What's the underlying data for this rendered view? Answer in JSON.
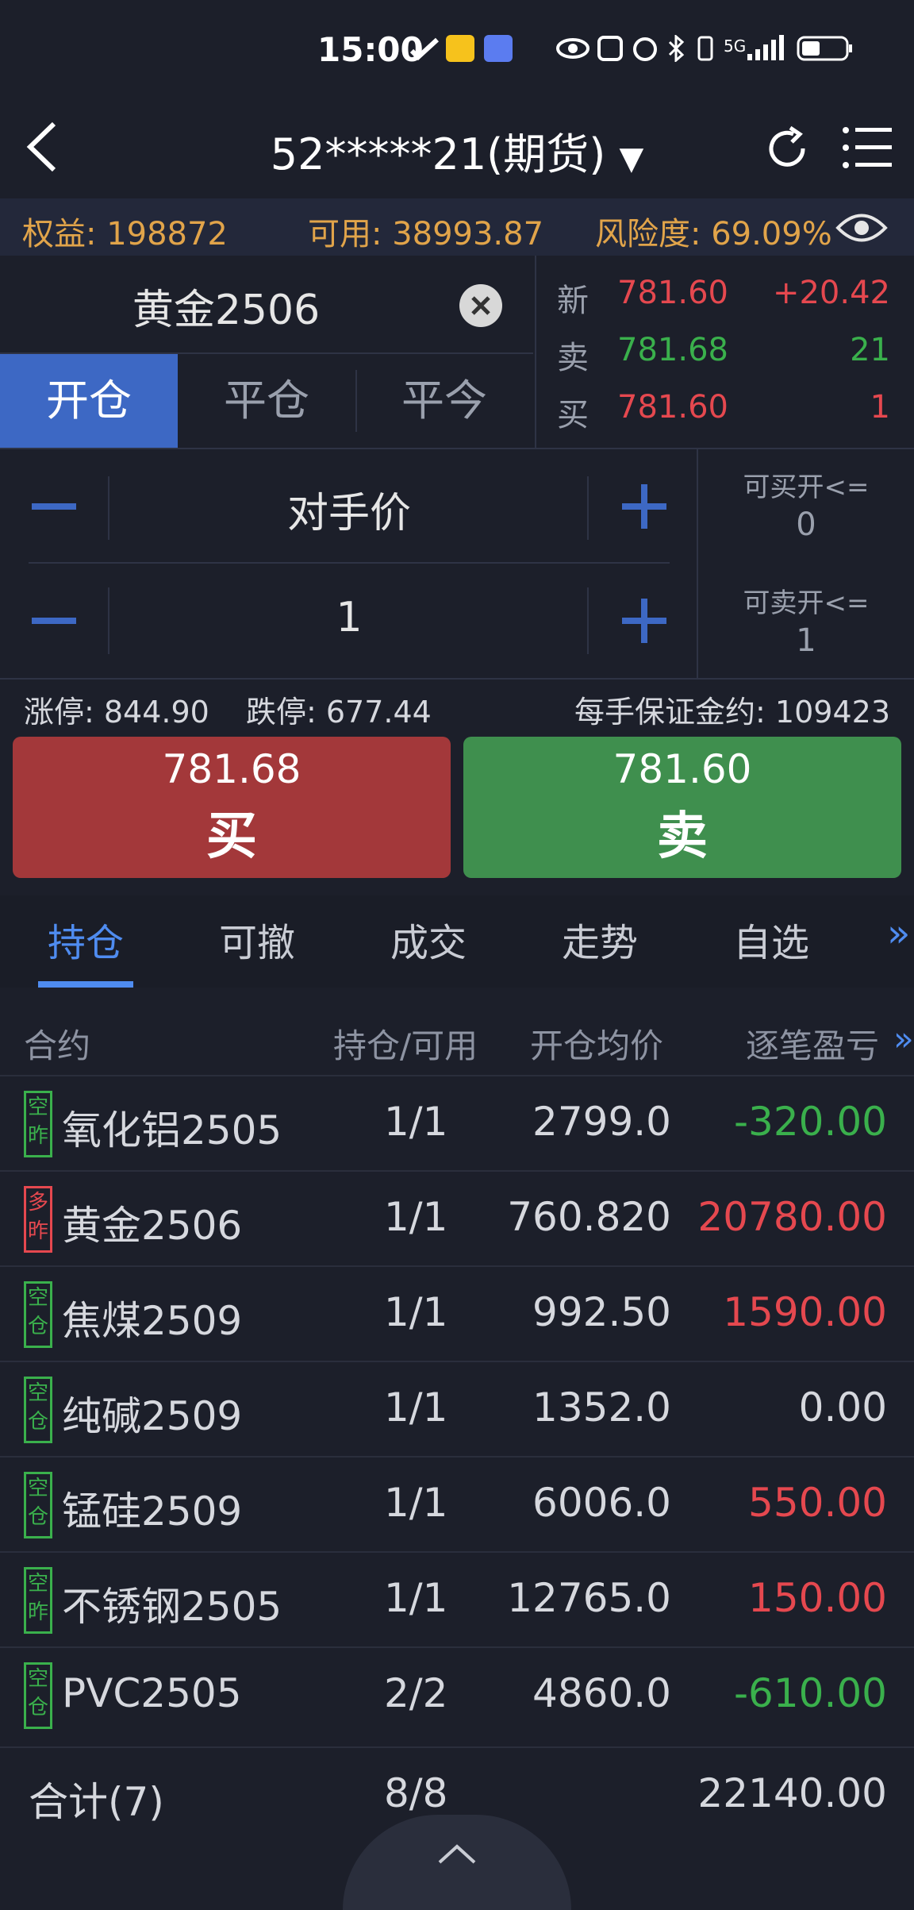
{
  "status_bar": {
    "time": "15:00",
    "network": "5G"
  },
  "header": {
    "account": "52*****21(期货)"
  },
  "equity": {
    "quanyi": "权益: 198872",
    "keyong": "可用: 38993.87",
    "risk": "风险度: 69.09%"
  },
  "instrument": {
    "name": "黄金2506"
  },
  "order_tabs": [
    "开仓",
    "平仓",
    "平今"
  ],
  "quote": [
    {
      "label": "新",
      "price": "781.60",
      "right": "+20.42"
    },
    {
      "label": "卖",
      "price": "781.68",
      "right": "21"
    },
    {
      "label": "买",
      "price": "781.60",
      "right": "1"
    }
  ],
  "price_field": {
    "value": "对手价"
  },
  "qty_field": {
    "value": "1"
  },
  "can_buy": {
    "label": "可买开<=",
    "value": "0"
  },
  "can_sell": {
    "label": "可卖开<=",
    "value": "1"
  },
  "limits": {
    "up": "涨停: 844.90",
    "down": "跌停: 677.44",
    "margin": "每手保证金约: 109423"
  },
  "buy_button": {
    "price": "781.68",
    "label": "买"
  },
  "sell_button": {
    "price": "781.60",
    "label": "卖"
  },
  "tabs": [
    "持仓",
    "可撤",
    "成交",
    "走势",
    "自选",
    "»"
  ],
  "table": {
    "headers": [
      "合约",
      "持仓/可用",
      "开仓均价",
      "逐笔盈亏",
      "»"
    ],
    "rows": [
      {
        "tag": "空昨",
        "tagc": "green",
        "name": "氧化铝2505",
        "pos": "1/1",
        "avg": "2799.0",
        "pnl": "-320.00",
        "pnlc": "green"
      },
      {
        "tag": "多昨",
        "tagc": "red",
        "name": "黄金2506",
        "pos": "1/1",
        "avg": "760.820",
        "pnl": "20780.00",
        "pnlc": "red"
      },
      {
        "tag": "空仓",
        "tagc": "green",
        "name": "焦煤2509",
        "pos": "1/1",
        "avg": "992.50",
        "pnl": "1590.00",
        "pnlc": "red"
      },
      {
        "tag": "空仓",
        "tagc": "green",
        "name": "纯碱2509",
        "pos": "1/1",
        "avg": "1352.0",
        "pnl": "0.00",
        "pnlc": "white"
      },
      {
        "tag": "空仓",
        "tagc": "green",
        "name": "锰硅2509",
        "pos": "1/1",
        "avg": "6006.0",
        "pnl": "550.00",
        "pnlc": "red"
      },
      {
        "tag": "空昨",
        "tagc": "green",
        "name": "不锈钢2505",
        "pos": "1/1",
        "avg": "12765.0",
        "pnl": "150.00",
        "pnlc": "red"
      },
      {
        "tag": "空仓",
        "tagc": "green",
        "name": "PVC2505",
        "pos": "2/2",
        "avg": "4860.0",
        "pnl": "-610.00",
        "pnlc": "green"
      }
    ],
    "total": {
      "label": "合计(7)",
      "pos": "8/8",
      "pnl": "22140.00"
    }
  },
  "colors": {
    "accent": "#3d68c4",
    "buy": "#a3383a",
    "sell": "#3f8f4e",
    "equity": "#e1a44a"
  }
}
